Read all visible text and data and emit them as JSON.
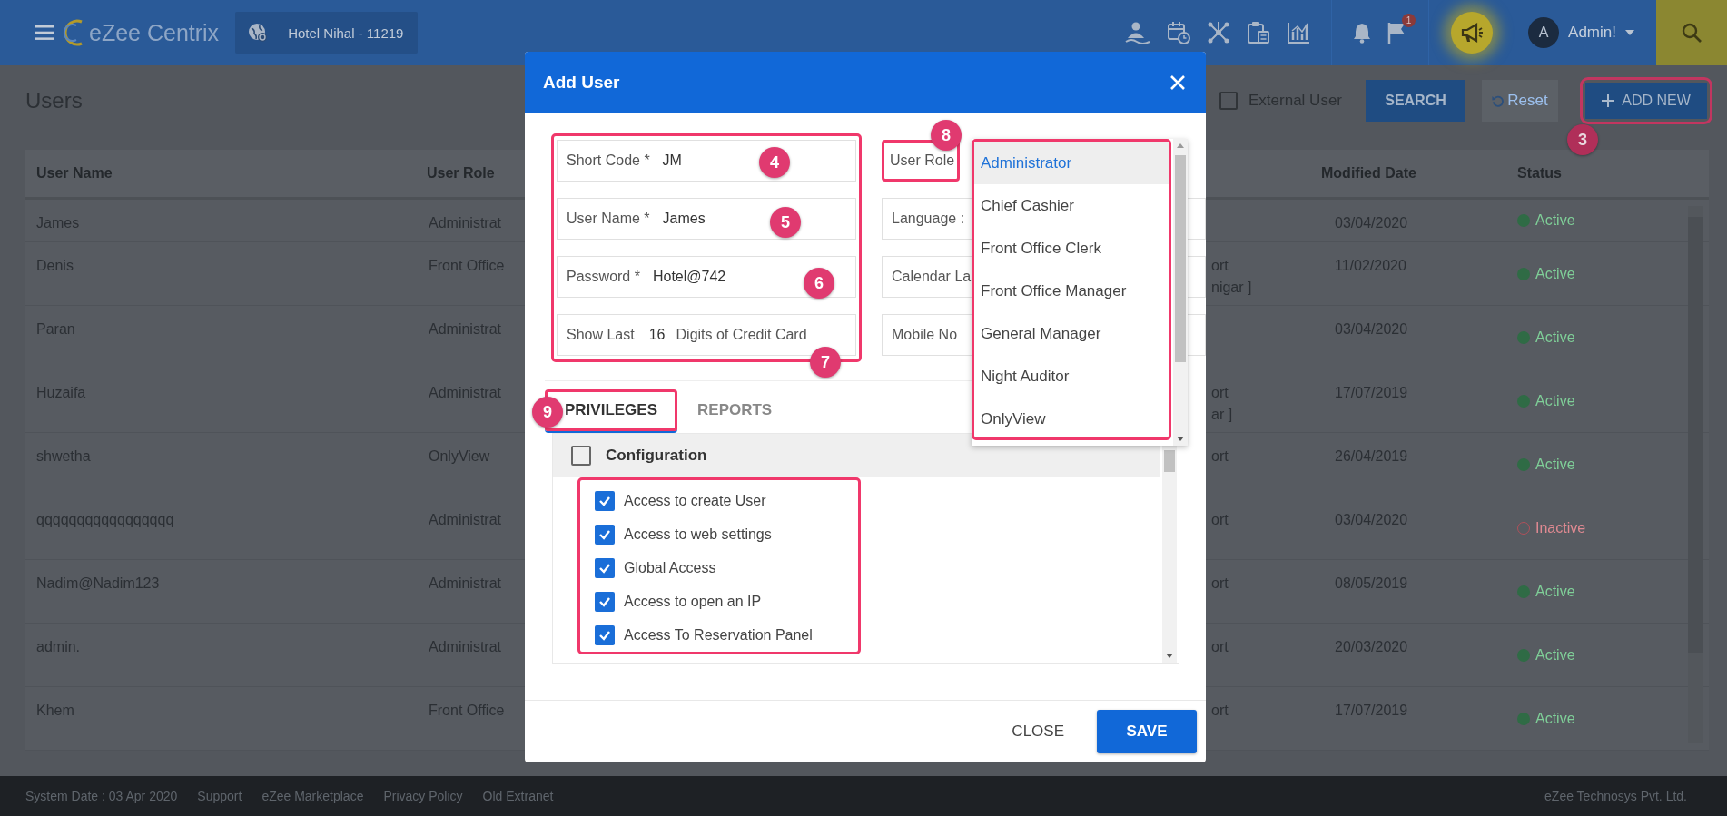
{
  "header": {
    "logo": "eZee Centrix",
    "hotel": "Hotel Nihal -  11219",
    "notification_count": "1",
    "user": {
      "initial": "A",
      "name": "Admin!"
    }
  },
  "toolbar": {
    "title": "Users",
    "external_user": {
      "label": "External User",
      "checked": false
    },
    "search_button": "SEARCH",
    "reset_button": "Reset",
    "add_new": {
      "label": "ADD NEW",
      "highlighted": true,
      "callout": "3"
    }
  },
  "table": {
    "columns": [
      {
        "label": "User Name"
      },
      {
        "label": "User Role"
      },
      {
        "label": "Modified Date"
      },
      {
        "label": "Status"
      }
    ],
    "rows": [
      {
        "user_name": "James",
        "user_role": "Administrat",
        "modified_date": "03/04/2020",
        "status": "Active",
        "active": true
      },
      {
        "user_name": "Denis",
        "user_role": "Front Office",
        "column_3": [
          "ort",
          "nigar ]"
        ],
        "modified_date": "11/02/2020",
        "status": "Active",
        "active": true
      },
      {
        "user_name": "Paran",
        "user_role": "Administrat",
        "modified_date": "03/04/2020",
        "status": "Active",
        "active": true
      },
      {
        "user_name": "Huzaifa",
        "user_role": "Administrat",
        "column_3": [
          "ort",
          "ar ]"
        ],
        "modified_date": "17/07/2019",
        "status": "Active",
        "active": true
      },
      {
        "user_name": "shwetha",
        "user_role": "OnlyView",
        "column_3": [
          "ort"
        ],
        "modified_date": "26/04/2019",
        "status": "Active",
        "active": true
      },
      {
        "user_name": "qqqqqqqqqqqqqqqqq",
        "user_role": "Administrat",
        "column_3": [
          "ort"
        ],
        "modified_date": "03/04/2020",
        "status": "Inactive",
        "active": false
      },
      {
        "user_name": "Nadim@Nadim123",
        "user_role": "Administrat",
        "column_3": [
          "ort"
        ],
        "modified_date": "08/05/2019",
        "status": "Active",
        "active": true
      },
      {
        "user_name": "admin.",
        "user_role": "Administrat",
        "column_3": [
          "ort"
        ],
        "modified_date": "20/03/2020",
        "status": "Active",
        "active": true
      },
      {
        "user_name": "Khem",
        "user_role": "Front Office",
        "column_3": [
          "ort"
        ],
        "modified_date": "17/07/2019",
        "status": "Active",
        "active": true
      }
    ]
  },
  "modal": {
    "title": "Add User",
    "fields_highlighted": true,
    "fields": [
      {
        "kind": "text",
        "label": "Short Code *",
        "value": "JM",
        "callout": "4"
      },
      {
        "kind": "text",
        "label": "User Name *",
        "value": "James",
        "callout": "5"
      },
      {
        "kind": "text",
        "label": "Password *",
        "value": "Hotel@742",
        "callout": "6"
      },
      {
        "kind": "digits",
        "label": "Show Last",
        "value": "16",
        "suffix": "Digits of Credit Card",
        "callout": "7"
      }
    ],
    "right_fields": [
      {
        "label": "User Role",
        "highlighted": true,
        "callout": "8"
      },
      {
        "label": "Language :",
        "highlighted": false
      },
      {
        "label": "Calendar La",
        "highlighted": false
      },
      {
        "label": "Mobile No",
        "highlighted": false
      }
    ],
    "role_list": {
      "highlighted": true,
      "options": [
        {
          "label": "Administrator",
          "selected": true
        },
        {
          "label": "Chief Cashier",
          "selected": false
        },
        {
          "label": "Front Office Clerk",
          "selected": false
        },
        {
          "label": "Front Office Manager",
          "selected": false
        },
        {
          "label": "General Manager",
          "selected": false
        },
        {
          "label": "Night Auditor",
          "selected": false
        },
        {
          "label": "OnlyView",
          "selected": false
        }
      ]
    },
    "tabs": [
      {
        "label": "PRIVILEGES",
        "selected": true,
        "highlighted": true,
        "callout": "9"
      },
      {
        "label": "REPORTS",
        "selected": false,
        "highlighted": false
      }
    ],
    "privileges": {
      "group": {
        "label": "Configuration",
        "checked": false
      },
      "items_highlighted": true,
      "items": [
        {
          "label": "Access to create User",
          "checked": true
        },
        {
          "label": "Access to web settings",
          "checked": true
        },
        {
          "label": "Global Access",
          "checked": true
        },
        {
          "label": "Access to open an IP",
          "checked": true
        },
        {
          "label": "Access To Reservation Panel",
          "checked": true
        }
      ]
    },
    "close_button": "CLOSE",
    "save_button": "SAVE"
  },
  "footer": {
    "links": [
      {
        "label": "System Date : 03 Apr 2020"
      },
      {
        "label": "Support"
      },
      {
        "label": "eZee Marketplace"
      },
      {
        "label": "Privacy Policy"
      },
      {
        "label": "Old Extranet"
      }
    ],
    "company": "eZee Technosys Pvt. Ltd."
  }
}
